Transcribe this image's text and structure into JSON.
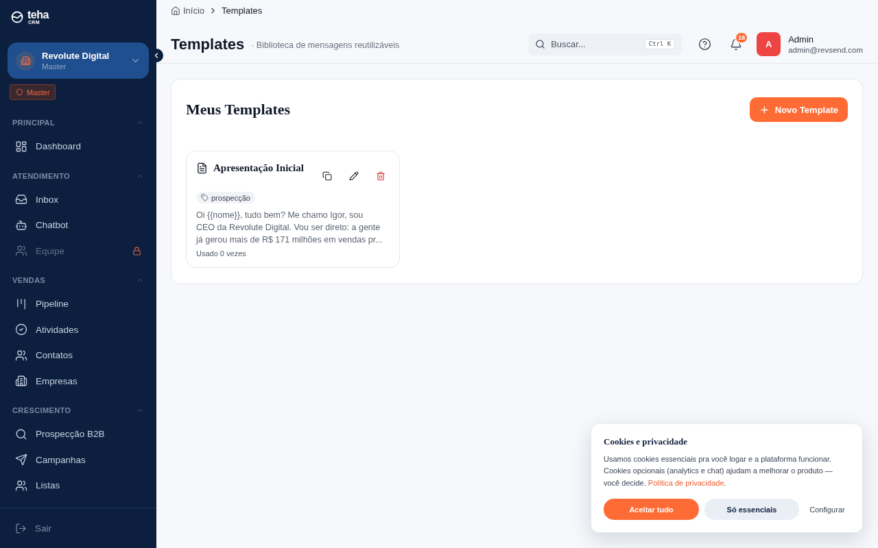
{
  "sidebar": {
    "logo": {
      "name": "teha",
      "tagline": "CRM"
    },
    "workspace": {
      "name": "Revolute Digital",
      "role": "Master",
      "expanded": false
    },
    "role_badge": "Master",
    "sections": [
      {
        "title": "PRINCIPAL",
        "expanded": true,
        "items": [
          {
            "label": "Dashboard",
            "disabled": false
          }
        ]
      },
      {
        "title": "ATENDIMENTO",
        "expanded": true,
        "items": [
          {
            "label": "Inbox",
            "disabled": false
          },
          {
            "label": "Chatbot",
            "disabled": false
          },
          {
            "label": "Equipe",
            "disabled": true
          }
        ]
      },
      {
        "title": "VENDAS",
        "expanded": true,
        "items": [
          {
            "label": "Pipeline",
            "disabled": false
          },
          {
            "label": "Atividades",
            "disabled": false
          },
          {
            "label": "Contatos",
            "disabled": false
          },
          {
            "label": "Empresas",
            "disabled": false
          }
        ]
      },
      {
        "title": "CRESCIMENTO",
        "expanded": true,
        "items": [
          {
            "label": "Prospecção B2B",
            "disabled": false
          },
          {
            "label": "Campanhas",
            "disabled": false
          },
          {
            "label": "Listas",
            "disabled": false
          }
        ]
      }
    ],
    "logout": "Sair"
  },
  "header": {
    "breadcrumb": [
      {
        "label": "Início",
        "kind": "home"
      },
      {
        "label": "Templates",
        "kind": "current"
      }
    ],
    "title": "Templates",
    "subtitle": "· Biblioteca de mensagens reutilizáveis",
    "search": {
      "placeholder": "Buscar...",
      "shortcut": "Ctrl K"
    },
    "notification_count": "16",
    "user": {
      "initial": "A",
      "name": "Admin",
      "email": "admin@revsend.com"
    }
  },
  "panel": {
    "title": "Meus Templates",
    "new_button": "Novo Template",
    "templates": [
      {
        "title": "Apresentação Inicial",
        "tags": [
          "prospecção"
        ],
        "body": "Oi {{nome}}, tudo bem? Me chamo Igor, sou CEO da Revolute Digital. Vou ser direto: a gente já gerou mais de R$ 171 milhões em vendas pr...",
        "usage": "Usado 0 vezes"
      }
    ]
  },
  "cookie_banner": {
    "title": "Cookies e privacidade",
    "text": "Usamos cookies essenciais pra você logar e a plataforma funcionar. Cookies opcionais (analytics e chat) ajudam a melhorar o produto — você decide. ",
    "link": "Política de privacidade",
    "after_link": ".",
    "buttons": [
      {
        "label": "Aceitar tudo",
        "kind": "primary"
      },
      {
        "label": "Só essenciais",
        "kind": "secondary"
      },
      {
        "label": "Configurar",
        "kind": "text"
      }
    ]
  }
}
